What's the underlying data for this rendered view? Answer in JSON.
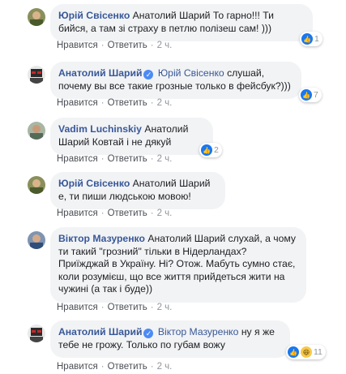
{
  "comments": [
    {
      "author": "Юрій Свісенко",
      "verified": false,
      "mention": "",
      "text": "Анатолий Шарий То гарно!!! Ти бийся, а там зі страху в петлю полізеш сам! )))",
      "like_label": "Нравится",
      "reply_label": "Ответить",
      "time": "2 ч.",
      "reaction_count": "1",
      "reactions": [
        "like"
      ]
    },
    {
      "author": "Анатолий Шарий",
      "verified": true,
      "mention": "Юрій Свісенко",
      "text": "слушай, почему вы все такие грозные только в фейсбук?)))",
      "like_label": "Нравится",
      "reply_label": "Ответить",
      "time": "2 ч.",
      "reaction_count": "7",
      "reactions": [
        "like"
      ]
    },
    {
      "author": "Vadim Luchinskiy",
      "verified": false,
      "mention": "",
      "text": "Анатолий Шарий Ковтай і не дякуй",
      "like_label": "Нравится",
      "reply_label": "Ответить",
      "time": "2 ч.",
      "reaction_count": "2",
      "reactions": [
        "like"
      ]
    },
    {
      "author": "Юрій Свісенко",
      "verified": false,
      "mention": "",
      "text": "Анатолий Шарий е, ти пиши людською мовою!",
      "like_label": "Нравится",
      "reply_label": "Ответить",
      "time": "2 ч.",
      "reaction_count": "",
      "reactions": []
    },
    {
      "author": "Віктор Мазуренко",
      "verified": false,
      "mention": "",
      "text": "Анатолий Шарий слухай, а чому ти такий \"грозний\" тільки в Нідерландах? Приїжджай в Україну. Ні? Отож. Мабуть сумно стає, коли розумієш, що все життя прийдеться жити на чужині (а так і буде))",
      "like_label": "Нравится",
      "reply_label": "Ответить",
      "time": "2 ч.",
      "reaction_count": "",
      "reactions": []
    },
    {
      "author": "Анатолий Шарий",
      "verified": true,
      "mention": "Віктор Мазуренко",
      "text": "ну я же тебе не грожу. Только по губам вожу",
      "like_label": "Нравится",
      "reply_label": "Ответить",
      "time": "2 ч.",
      "reaction_count": "11",
      "reactions": [
        "like",
        "haha"
      ]
    }
  ],
  "colors": {
    "link": "#385898",
    "bubble": "#f2f3f5",
    "like": "#1877f2",
    "meta": "#90949c"
  }
}
